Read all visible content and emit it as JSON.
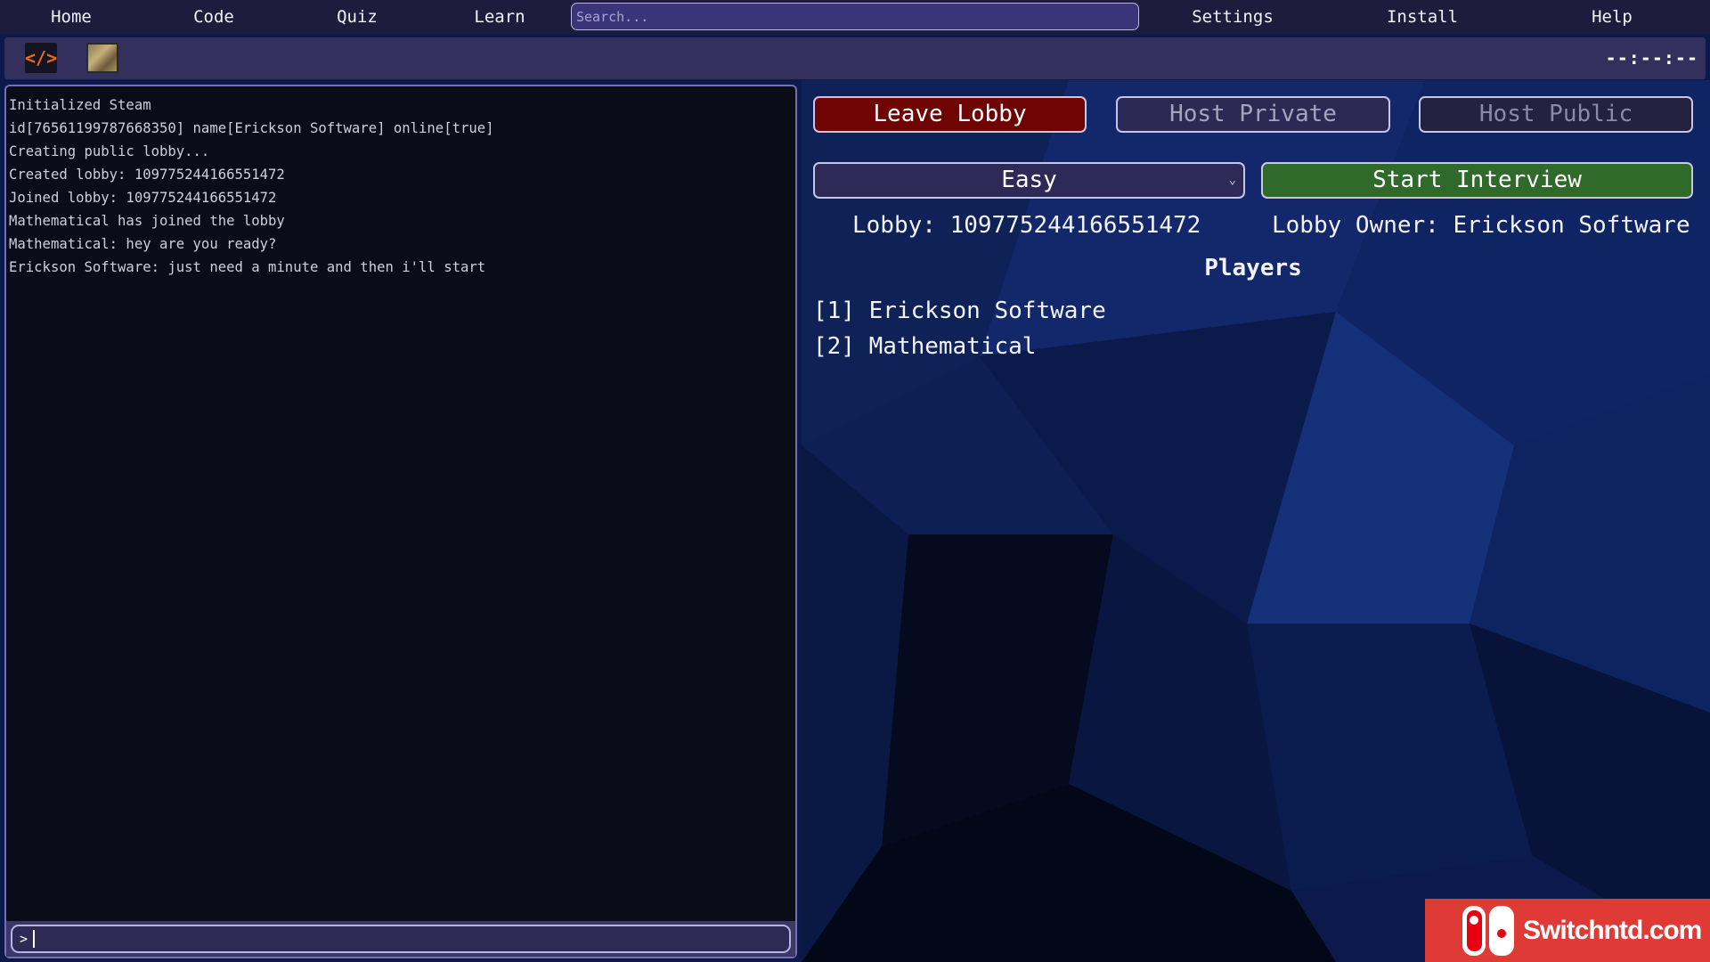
{
  "nav": {
    "items": [
      "Home",
      "Code",
      "Quiz",
      "Learn",
      "Settings",
      "Install",
      "Help"
    ],
    "search_placeholder": "Search..."
  },
  "toolbar": {
    "code_icon": "</>",
    "clock": "--:--:--"
  },
  "console": {
    "lines": [
      "Initialized Steam",
      "id[76561199787668350] name[Erickson Software] online[true]",
      "Creating public lobby...",
      "Created lobby: 109775244166551472",
      "Joined lobby: 109775244166551472",
      "Mathematical has joined the lobby",
      "Mathematical: hey are you ready?",
      "Erickson Software: just need a minute and then i'll start"
    ],
    "prompt": ">"
  },
  "lobby": {
    "leave_label": "Leave Lobby",
    "host_private_label": "Host Private",
    "host_public_label": "Host Public",
    "difficulty": "Easy",
    "start_label": "Start Interview",
    "lobby_id_text": "Lobby: 109775244166551472",
    "owner_text": "Lobby Owner: Erickson Software",
    "players_title": "Players",
    "players": [
      "[1] Erickson Software",
      "[2] Mathematical"
    ]
  },
  "colors": {
    "leave": "#6e0404",
    "start": "#2f6a2a",
    "nav": "#1e1c3c",
    "toolbar": "#34305e"
  },
  "watermark": {
    "text": "Switchntd.com"
  }
}
